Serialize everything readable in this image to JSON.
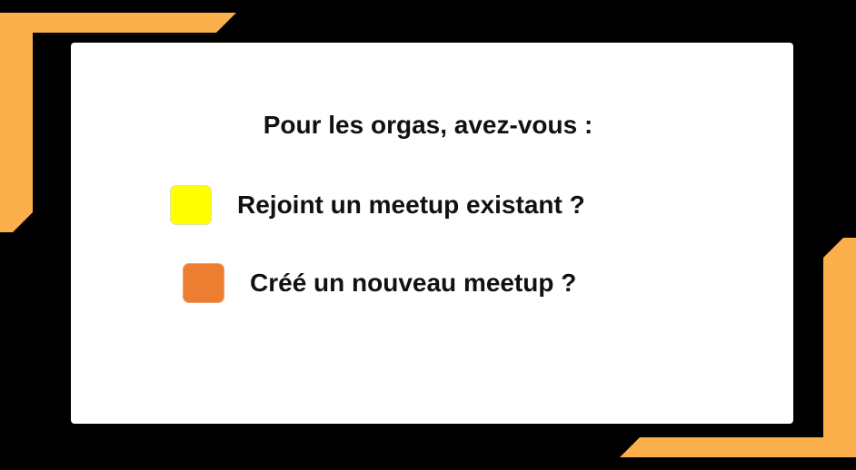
{
  "title": "Pour les orgas, avez-vous :",
  "options": [
    {
      "label": "Rejoint un meetup existant ?",
      "color": "#ffff00"
    },
    {
      "label": "Créé un nouveau meetup ?",
      "color": "#ed7d31"
    }
  ],
  "theme": {
    "background": "#000000",
    "accent": "#fbb04c",
    "card": "#ffffff"
  }
}
